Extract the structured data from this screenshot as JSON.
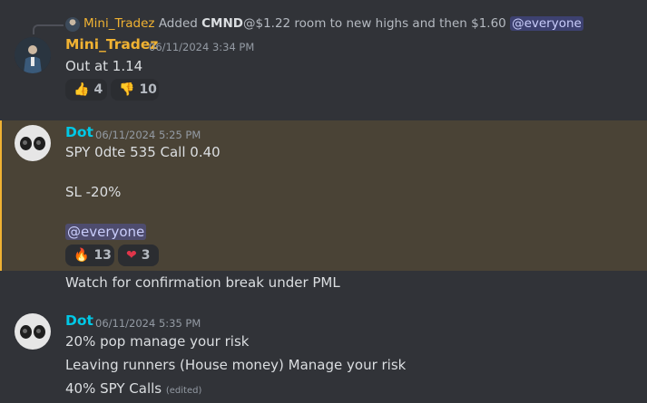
{
  "reply": {
    "author": "Mini_Tradez",
    "prefix": "Added",
    "ticker": "CMND",
    "text": "@$1.22 room to new highs and then $1.60",
    "mention": "@everyone"
  },
  "messages": [
    {
      "author": "Mini_Tradez",
      "timestamp": "06/11/2024 3:34 PM",
      "lines": [
        "Out at 1.14"
      ],
      "reactions": [
        {
          "emoji": "👍",
          "count": "4"
        },
        {
          "emoji": "👎",
          "count": "10"
        }
      ]
    },
    {
      "author": "Dot",
      "timestamp": "06/11/2024 5:25 PM",
      "lines": [
        "SPY 0dte 535  Call  0.40",
        "SL -20%",
        "@everyone"
      ],
      "reactions": [
        {
          "emoji": "🔥",
          "count": "13"
        },
        {
          "emoji": "❤",
          "count": "3"
        }
      ]
    },
    {
      "lines": [
        "Watch for confirmation break under PML"
      ]
    },
    {
      "author": "Dot",
      "timestamp": "06/11/2024 5:35 PM",
      "lines": [
        "20% pop manage your risk",
        "Leaving runners (House money) Manage your risk",
        "40% SPY Calls"
      ],
      "edited": "(edited)"
    }
  ],
  "colors": {
    "background": "#313338",
    "author_mini": "#f0b232",
    "author_dot": "#00c8e6",
    "highlight": "#4a4336",
    "mention_bg": "#5865f2"
  }
}
